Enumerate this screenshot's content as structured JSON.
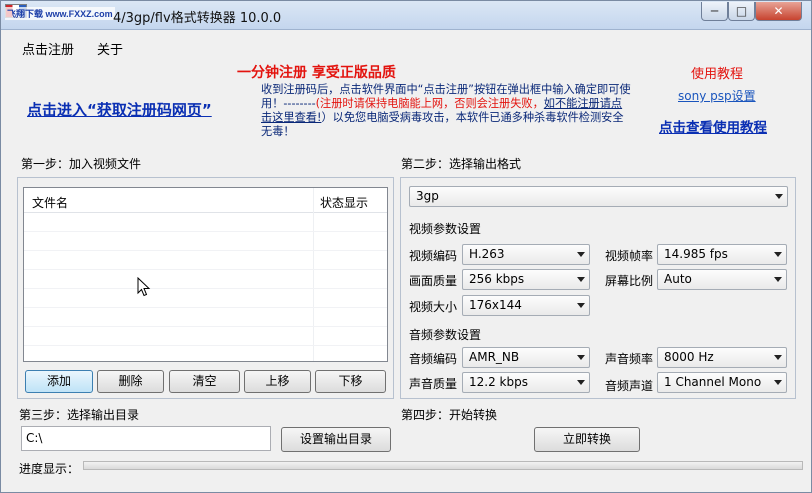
{
  "window": {
    "title": "4/3gp/flv格式转换器 10.0.0",
    "watermark": "飞翔下载 www.FXXZ.com",
    "min_glyph": "─",
    "max_glyph": "□",
    "close_glyph": "✕"
  },
  "menu": [
    {
      "label": "点击注册"
    },
    {
      "label": "关于"
    }
  ],
  "ads": {
    "headline": "一分钟注册  享受正版品质",
    "register_link": "点击进入“获取注册码网页”",
    "notice_1": "收到注册码后，点击软件界面中“点击注册”按钮在弹出框中输入确定即可使用！--------",
    "notice_red": "(注册时请保持电脑能上网，否则会注册失败，",
    "notice_link": "如不能注册请点击这里查看!",
    "notice_2": "）以免您电脑受病毒攻击，本软件已通多种杀毒软件检测安全无毒！",
    "tutorial_title": "使用教程",
    "sony_link": "sony psp设置",
    "view_tutorial": "点击查看使用教程"
  },
  "step1": {
    "label": "第一步：加入视频文件",
    "col_file": "文件名",
    "col_status": "状态显示",
    "buttons": [
      "添加",
      "删除",
      "清空",
      "上移",
      "下移"
    ]
  },
  "step2": {
    "label": "第二步：选择输出格式",
    "format": "3gp",
    "video_group": "视频参数设置",
    "video_codec_label": "视频编码",
    "video_codec": "H.263",
    "frame_rate_label": "视频帧率",
    "frame_rate": "14.985 fps",
    "quality_label": "画面质量",
    "quality": "256 kbps",
    "aspect_label": "屏幕比例",
    "aspect": "Auto",
    "size_label": "视频大小",
    "size": "176x144",
    "audio_group": "音频参数设置",
    "audio_codec_label": "音频编码",
    "audio_codec": "AMR_NB",
    "sample_rate_label": "声音频率",
    "sample_rate": "8000 Hz",
    "audio_quality_label": "声音质量",
    "audio_quality": "12.2 kbps",
    "channel_label": "音频声道",
    "channel": "1 Channel Mono"
  },
  "step3": {
    "label": "第三步：选择输出目录",
    "path": "C:\\",
    "button": "设置输出目录"
  },
  "step4": {
    "label": "第四步：开始转换",
    "button": "立即转换"
  },
  "progress": {
    "label": "进度显示：",
    "value": 0
  }
}
